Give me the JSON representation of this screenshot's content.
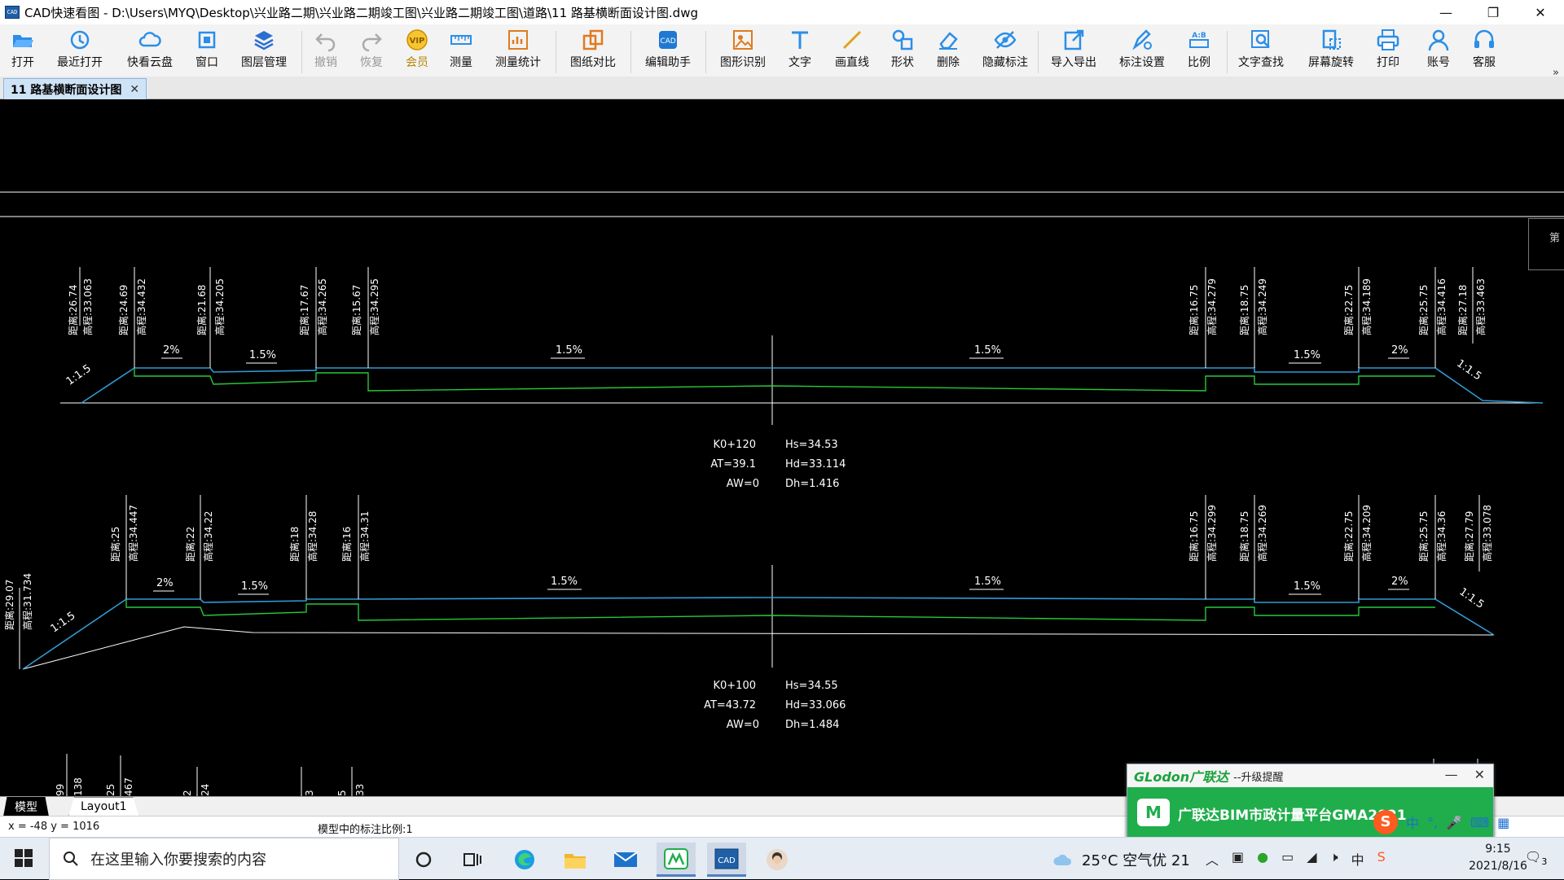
{
  "window": {
    "title": "CAD快速看图 - D:\\Users\\MYQ\\Desktop\\兴业路二期\\兴业路二期竣工图\\兴业路二期竣工图\\道路\\11 路基横断面设计图.dwg",
    "app_icon": "CAD",
    "minimize": "—",
    "restore": "❐",
    "close": "✕"
  },
  "toolbar": {
    "items": [
      {
        "label": "打开",
        "icon": "folder-open-icon"
      },
      {
        "label": "最近打开",
        "icon": "history-icon"
      },
      {
        "label": "快看云盘",
        "icon": "cloud-icon"
      },
      {
        "label": "窗口",
        "icon": "window-icon"
      },
      {
        "label": "图层管理",
        "icon": "layers-icon"
      },
      {
        "label": "撤销",
        "icon": "undo-icon"
      },
      {
        "label": "恢复",
        "icon": "redo-icon"
      },
      {
        "label": "会员",
        "icon": "vip-icon"
      },
      {
        "label": "测量",
        "icon": "ruler-icon"
      },
      {
        "label": "测量统计",
        "icon": "measure-stats-icon"
      },
      {
        "label": "图纸对比",
        "icon": "compare-icon"
      },
      {
        "label": "编辑助手",
        "icon": "edit-assistant-icon"
      },
      {
        "label": "图形识别",
        "icon": "shape-recognition-icon"
      },
      {
        "label": "文字",
        "icon": "text-icon"
      },
      {
        "label": "画直线",
        "icon": "line-icon"
      },
      {
        "label": "形状",
        "icon": "shape-icon"
      },
      {
        "label": "删除",
        "icon": "eraser-icon"
      },
      {
        "label": "隐藏标注",
        "icon": "hide-annotation-icon"
      },
      {
        "label": "导入导出",
        "icon": "import-export-icon"
      },
      {
        "label": "标注设置",
        "icon": "annotation-settings-icon"
      },
      {
        "label": "比例",
        "icon": "scale-icon"
      },
      {
        "label": "文字查找",
        "icon": "text-search-icon"
      },
      {
        "label": "屏幕旋转",
        "icon": "rotate-screen-icon"
      },
      {
        "label": "打印",
        "icon": "printer-icon"
      },
      {
        "label": "账号",
        "icon": "user-icon"
      },
      {
        "label": "客服",
        "icon": "headset-icon"
      }
    ],
    "more": "»"
  },
  "doc_tab": {
    "label": "11  路基横断面设计图",
    "close": "✕"
  },
  "side_panel": {
    "label": "第"
  },
  "drawing": {
    "colors": {
      "top_line": "#2f9bd6",
      "bottom_line": "#26c83c",
      "ground": "#ffffff",
      "text": "#ffffff"
    },
    "section1": {
      "top_labels": [
        "距离:26.74",
        "高程:33.063",
        "距离:24.69",
        "高程:34.432",
        "距离:21.68",
        "高程:34.205",
        "距离:17.67",
        "高程:34.265",
        "距离:15.67",
        "高程:34.295",
        "距离:16.75",
        "高程:34.279",
        "距离:18.75",
        "高程:34.249",
        "距离:22.75",
        "高程:34.189",
        "距离:25.75",
        "高程:34.416",
        "距离:27.18",
        "高程:33.463"
      ],
      "slopes": [
        "1:1.5",
        "2%",
        "1.5%",
        "1.5%",
        "1.5%",
        "1.5%",
        "2%",
        "1:1.5"
      ],
      "info": {
        "station": "K0+120",
        "at": "AT=39.1",
        "aw": "AW=0",
        "hs": "Hs=34.53",
        "hd": "Hd=33.114",
        "dh": "Dh=1.416"
      }
    },
    "section2": {
      "top_labels": [
        "距离:29.07",
        "高程:31.734",
        "距离:25",
        "高程:34.447",
        "距离:22",
        "高程:34.22",
        "距离:18",
        "高程:34.28",
        "距离:16",
        "高程:34.31",
        "距离:16.75",
        "高程:34.299",
        "距离:18.75",
        "高程:34.269",
        "距离:22.75",
        "高程:34.209",
        "距离:25.75",
        "高程:34.36",
        "距离:27.79",
        "高程:33.078"
      ],
      "slopes": [
        "1:1.5",
        "2%",
        "1.5%",
        "1.5%",
        "1.5%",
        "1.5%",
        "2%",
        "1:1.5"
      ],
      "info": {
        "station": "K0+100",
        "at": "AT=43.72",
        "aw": "AW=0",
        "hs": "Hs=34.55",
        "hd": "Hd=33.066",
        "dh": "Dh=1.484"
      }
    },
    "section3_partial": [
      "99",
      "138",
      "25",
      "467",
      "2",
      "24",
      "3",
      "5",
      "33"
    ]
  },
  "layout_tabs": {
    "model": "模型",
    "layout1": "Layout1"
  },
  "status": {
    "coords": "x = -48  y = 1016",
    "scale": "模型中的标注比例:1"
  },
  "popup": {
    "logo": "GLodon广联达",
    "title": "--升级提醒",
    "minimize": "—",
    "close": "✕",
    "body": "广联达BIM市政计量平台GMA2021"
  },
  "ime": {
    "logo": "S",
    "lang": "中",
    "items": [
      "°,",
      "🎤",
      "⌨",
      "▦"
    ]
  },
  "taskbar": {
    "search_placeholder": "在这里输入你要搜索的内容",
    "weather": "25°C  空气优 21",
    "time": "9:15",
    "date": "2021/8/16",
    "notifications": "3"
  }
}
